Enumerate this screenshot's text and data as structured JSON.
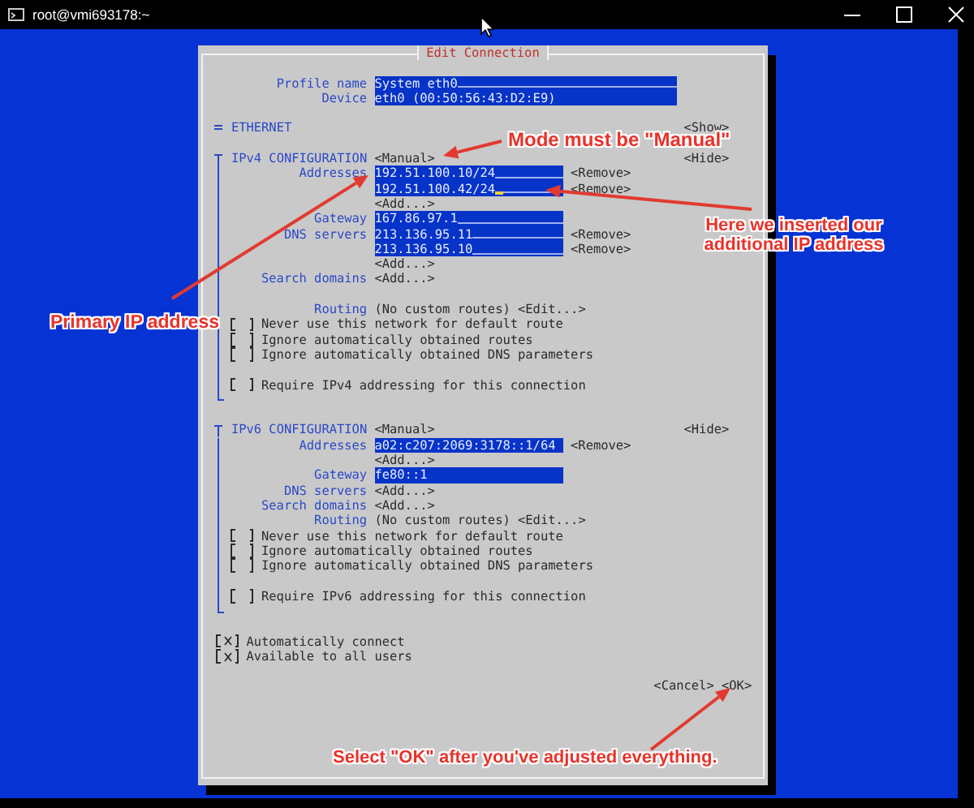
{
  "window": {
    "title": "root@vmi693178:~"
  },
  "dialog": {
    "title": "Edit Connection",
    "profile": [
      {
        "label": "Profile name",
        "value": "System eth0",
        "filler": true
      },
      {
        "label": "Device",
        "value": "eth0 (00:50:56:43:D2:E9)",
        "filler": false
      }
    ],
    "sections": [
      {
        "name": "ETHERNET",
        "expanded": false,
        "toggle": "<Show>"
      },
      {
        "name": "IPv4 CONFIGURATION",
        "mode": "<Manual>",
        "expanded": true,
        "toggle": "<Hide>",
        "rows": [
          {
            "kind": "field",
            "label": "Addresses",
            "value": "192.51.100.10/24",
            "filler": true,
            "focused": false,
            "action": "<Remove>"
          },
          {
            "kind": "field",
            "value": "192.51.100.42/24",
            "filler": true,
            "focused": true,
            "action": "<Remove>"
          },
          {
            "kind": "add",
            "button": "<Add...>"
          },
          {
            "kind": "field",
            "label": "Gateway",
            "value": "167.86.97.1",
            "filler": true,
            "focused": false
          },
          {
            "kind": "field",
            "label": "DNS servers",
            "value": "213.136.95.11",
            "filler": true,
            "focused": false,
            "action": "<Remove>"
          },
          {
            "kind": "field",
            "value": "213.136.95.10",
            "filler": true,
            "focused": false,
            "action": "<Remove>"
          },
          {
            "kind": "add",
            "button": "<Add...>"
          },
          {
            "kind": "add",
            "label": "Search domains",
            "button": "<Add...>"
          },
          {
            "kind": "routing",
            "label": "Routing",
            "value": "(No custom routes)",
            "button": "<Edit...>",
            "space_before": true
          },
          {
            "kind": "checkbox",
            "label": "Never use this network for default route",
            "checked": false
          },
          {
            "kind": "checkbox",
            "label": "Ignore automatically obtained routes",
            "checked": false
          },
          {
            "kind": "checkbox",
            "label": "Ignore automatically obtained DNS parameters",
            "checked": false
          },
          {
            "kind": "checkbox",
            "label": "Require IPv4 addressing for this connection",
            "checked": false,
            "space_before": true
          }
        ]
      },
      {
        "name": "IPv6 CONFIGURATION",
        "mode": "<Manual>",
        "expanded": true,
        "toggle": "<Hide>",
        "rows": [
          {
            "kind": "field",
            "label": "Addresses",
            "value": "a02:c207:2069:3178::1/64",
            "filler": false,
            "focused": false,
            "action": "<Remove>"
          },
          {
            "kind": "add",
            "button": "<Add...>"
          },
          {
            "kind": "field",
            "label": "Gateway",
            "value": "fe80::1",
            "filler": false,
            "focused": false
          },
          {
            "kind": "add",
            "label": "DNS servers",
            "button": "<Add...>"
          },
          {
            "kind": "add",
            "label": "Search domains",
            "button": "<Add...>"
          },
          {
            "kind": "routing",
            "label": "Routing",
            "value": "(No custom routes)",
            "button": "<Edit...>"
          },
          {
            "kind": "checkbox",
            "label": "Never use this network for default route",
            "checked": false
          },
          {
            "kind": "checkbox",
            "label": "Ignore automatically obtained routes",
            "checked": false
          },
          {
            "kind": "checkbox",
            "label": "Ignore automatically obtained DNS parameters",
            "checked": false
          },
          {
            "kind": "checkbox",
            "label": "Require IPv6 addressing for this connection",
            "checked": false,
            "space_before": true
          }
        ]
      }
    ],
    "options": [
      {
        "label": "Automatically connect",
        "checked": true
      },
      {
        "label": "Available to all users",
        "checked": true
      }
    ],
    "buttons": [
      "<Cancel>",
      "<OK>"
    ]
  },
  "annotations": [
    {
      "text": "Mode must be \"Manual\""
    },
    {
      "text": "Here we inserted our additional IP address"
    },
    {
      "text": "Primary IP address"
    },
    {
      "text": "Select \"OK\" after you've adjusted everything."
    }
  ]
}
